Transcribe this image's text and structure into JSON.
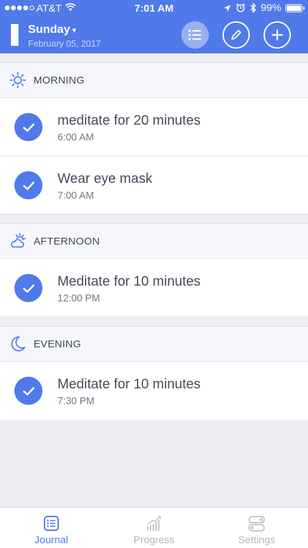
{
  "status_bar": {
    "carrier": "AT&T",
    "time": "7:01 AM",
    "battery": "99%",
    "battery_level": 0.99,
    "signal_bars_filled": 4,
    "signal_bars_total": 5
  },
  "header": {
    "day": "Sunday",
    "caret": "▾",
    "date": "February 05, 2017",
    "buttons": [
      "list-icon",
      "pencil-icon",
      "plus-icon"
    ]
  },
  "sections": [
    {
      "title": "MORNING",
      "icon": "sun-icon",
      "tasks": [
        {
          "title": "meditate for 20 minutes",
          "time": "6:00 AM",
          "done": true
        },
        {
          "title": "Wear eye mask",
          "time": "7:00 AM",
          "done": true
        }
      ]
    },
    {
      "title": "AFTERNOON",
      "icon": "partly-cloudy-icon",
      "tasks": [
        {
          "title": "Meditate for 10 minutes",
          "time": "12:00 PM",
          "done": true
        }
      ]
    },
    {
      "title": "EVENING",
      "icon": "moon-icon",
      "tasks": [
        {
          "title": "Meditate for 10 minutes",
          "time": "7:30 PM",
          "done": true
        }
      ]
    }
  ],
  "tabs": [
    {
      "label": "Journal",
      "icon": "journal-icon",
      "active": true
    },
    {
      "label": "Progress",
      "icon": "progress-chart-icon",
      "active": false
    },
    {
      "label": "Settings",
      "icon": "settings-toggles-icon",
      "active": false
    }
  ],
  "colors": {
    "accent": "#5079ea",
    "inactive": "#b3b6bd",
    "background": "#eceef2"
  }
}
